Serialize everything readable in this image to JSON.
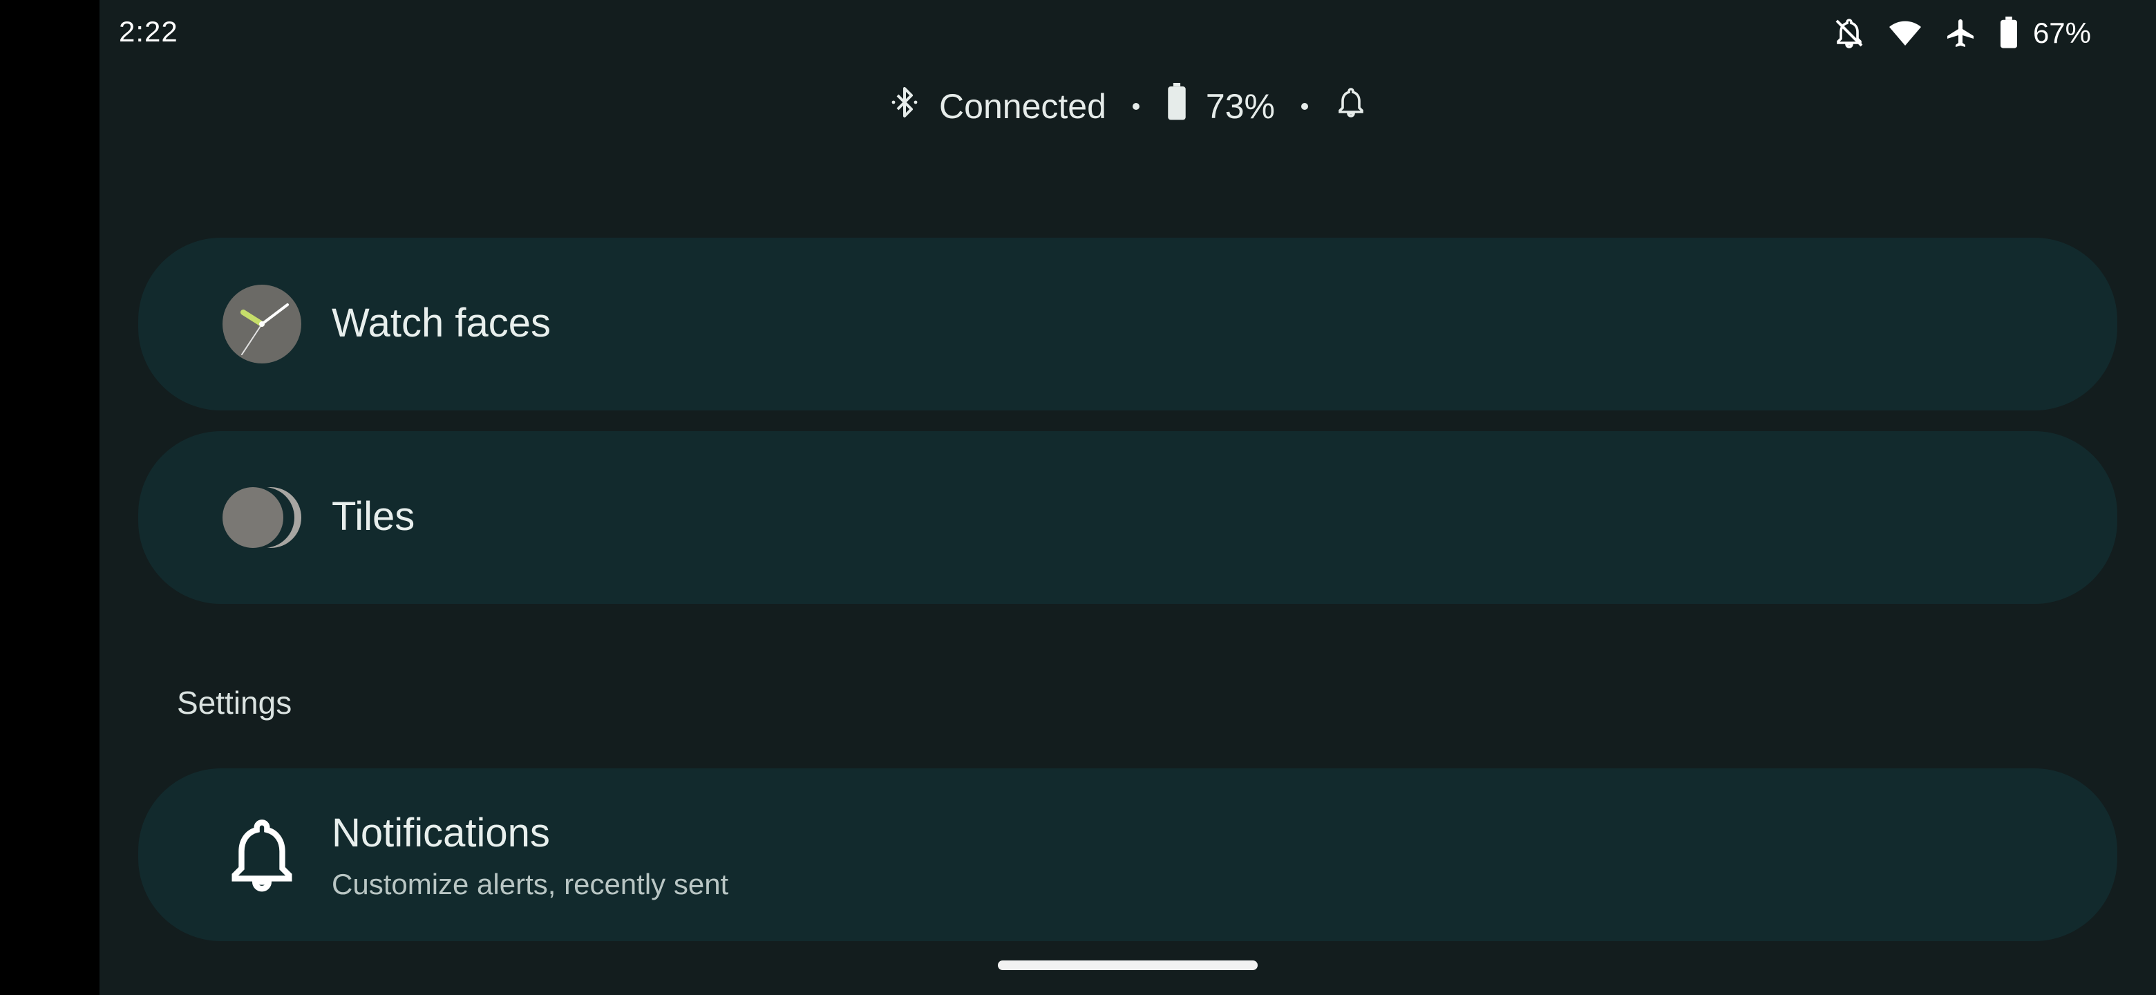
{
  "status_bar": {
    "time": "2:22",
    "battery_percent": "67%",
    "icons": [
      "notifications-off-icon",
      "wifi-icon",
      "airplane-icon",
      "battery-icon"
    ]
  },
  "device_summary": {
    "connection_status": "Connected",
    "watch_battery": "73%",
    "icons": [
      "bluetooth-icon",
      "watch-battery-icon",
      "bell-icon"
    ]
  },
  "cards": {
    "watch_faces": {
      "title": "Watch faces",
      "icon": "watch-face-icon"
    },
    "tiles": {
      "title": "Tiles",
      "icon": "tiles-icon"
    }
  },
  "settings": {
    "header": "Settings",
    "notifications": {
      "title": "Notifications",
      "subtitle": "Customize alerts, recently sent",
      "icon": "bell-icon"
    }
  },
  "colors": {
    "background": "#131d1e",
    "card": "#122a2d",
    "text_primary": "#e8efed",
    "text_secondary": "#b9c6c4",
    "watch_hand_accent": "#c6de6a"
  }
}
